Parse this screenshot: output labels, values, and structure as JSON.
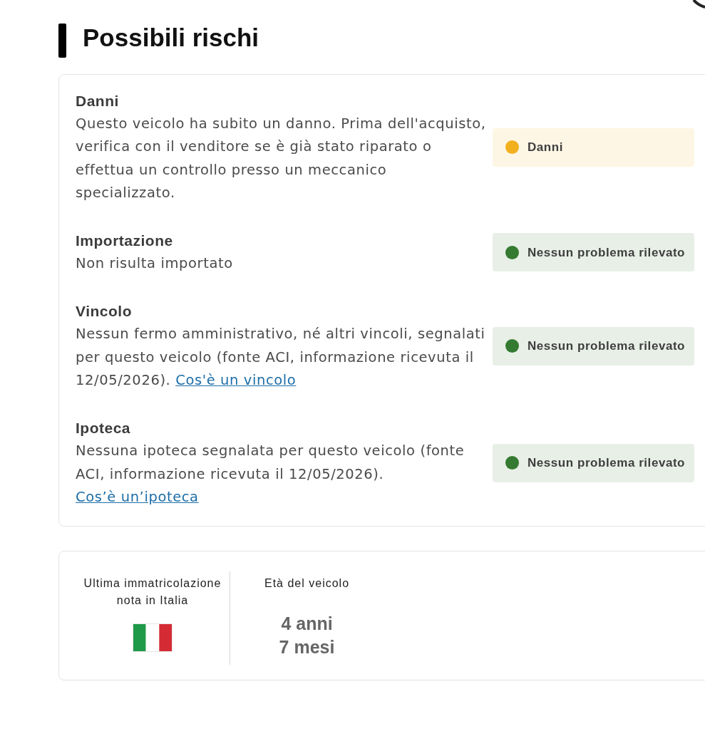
{
  "header": {
    "title": "Possibili rischi"
  },
  "risks": [
    {
      "title": "Danni",
      "description": "Questo veicolo ha subito un danno. Prima dell'acquisto, verifica con il venditore se è già stato riparato o effettua un controllo presso un meccanico specializzato.",
      "badge": {
        "label": "Danni",
        "color": "#f2b01e"
      }
    },
    {
      "title": "Importazione",
      "description": "Non risulta importato",
      "badge": {
        "label": "Nessun problema rilevato",
        "color": "#347a31"
      }
    },
    {
      "title": "Vincolo",
      "description": "Nessun fermo amministrativo, né altri vincoli, segnalati per questo veicolo (fonte ACI, informazione ricevuta il 12/05/2026).",
      "link": "Cos'è un vincolo",
      "badge": {
        "label": "Nessun problema rilevato",
        "color": "#347a31"
      }
    },
    {
      "title": "Ipoteca",
      "description": "Nessuna ipoteca segnalata per questo veicolo (fonte ACI, informazione ricevuta il 12/05/2026).",
      "link": "Cos’è un’ipoteca",
      "badge": {
        "label": "Nessun problema rilevato",
        "color": "#347a31"
      }
    }
  ],
  "facts": [
    {
      "kind": "flag",
      "label": "Ultima immatricolazione nota in Italia"
    },
    {
      "kind": "value",
      "label": "Età del veicolo",
      "values": [
        "4 anni",
        "7 mesi"
      ]
    }
  ]
}
